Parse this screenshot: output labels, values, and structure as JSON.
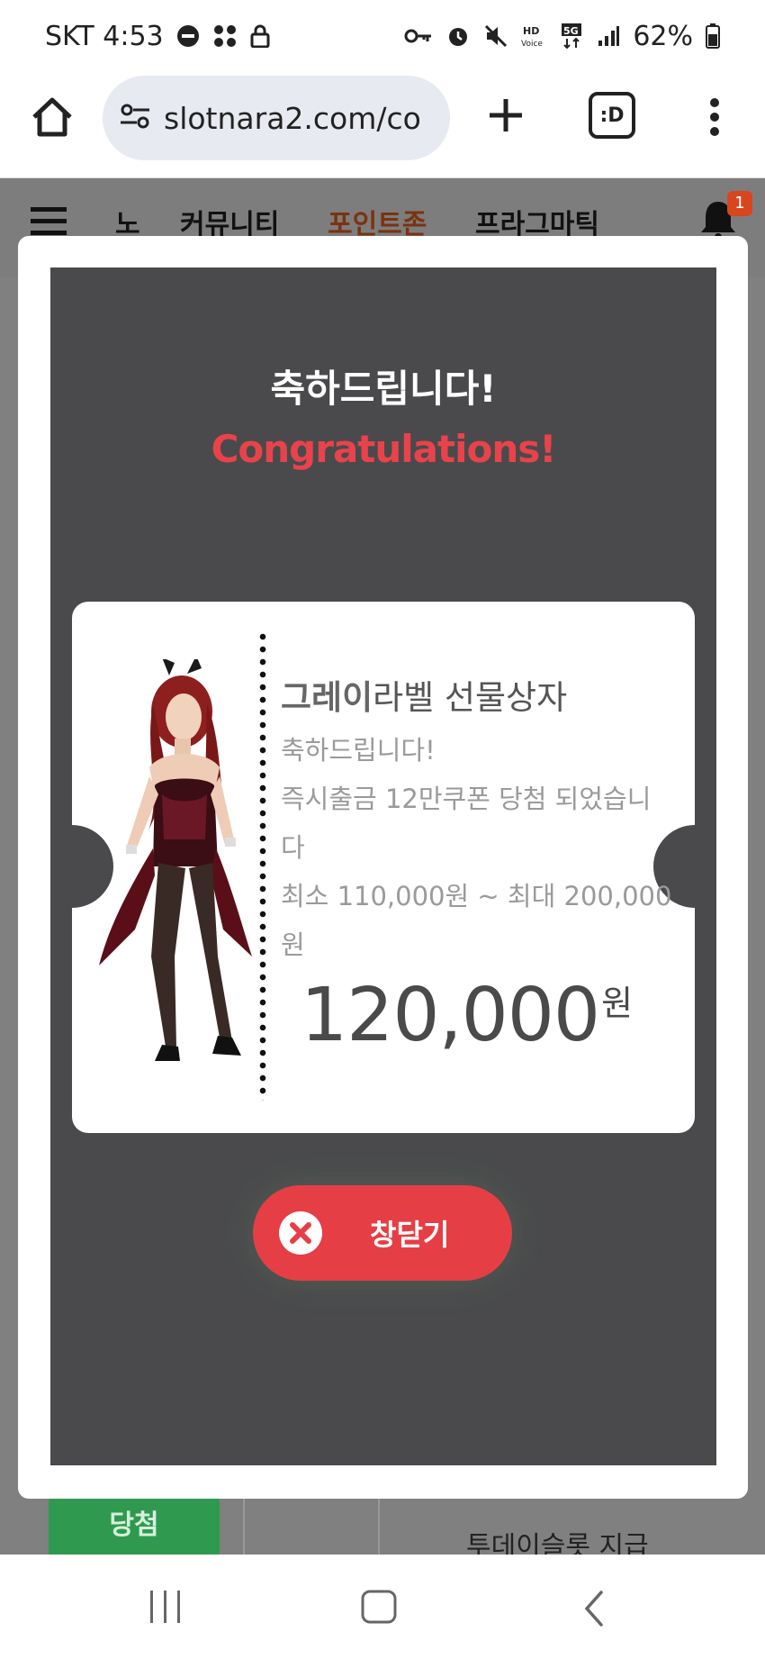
{
  "status_bar": {
    "carrier_time": "SKT 4:53",
    "battery": "62%",
    "network": "5G"
  },
  "browser": {
    "url": "slotnara2.com/co",
    "tab_label": ":D"
  },
  "site_nav": {
    "items": [
      "노",
      "커뮤니티",
      "포인트존",
      "프라그마틱"
    ],
    "active_color": "#c45a1a",
    "notification_count": "1"
  },
  "modal": {
    "title_ko": "축하드립니다!",
    "title_en": "Congratulations!",
    "card": {
      "title_highlight": "그레이",
      "title_rest": "라벨 선물상자",
      "line1": "축하드립니다!",
      "line2": "즉시출금 12만쿠폰 당첨 되었습니",
      "line3": "다",
      "line4": "최소 110,000원 ~ 최대 200,000",
      "line5": "원",
      "amount": "120,000",
      "amount_unit": "원"
    },
    "close_label": "창닫기"
  },
  "background": {
    "status_button": "당첨",
    "row_text": "투데이슬롯 지급"
  },
  "colors": {
    "modal_bg": "#4a4a4c",
    "accent_red": "#e63e45",
    "title_red": "#e8434b"
  }
}
